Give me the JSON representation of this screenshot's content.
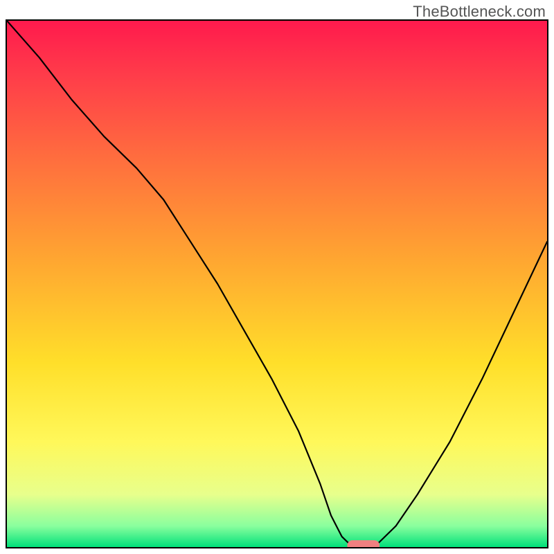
{
  "watermark": "TheBottleneck.com",
  "colors": {
    "gradient_stops": [
      {
        "offset": 0.0,
        "color": "#ff1a4d"
      },
      {
        "offset": 0.1,
        "color": "#ff3b4a"
      },
      {
        "offset": 0.25,
        "color": "#ff6a3f"
      },
      {
        "offset": 0.45,
        "color": "#ffa531"
      },
      {
        "offset": 0.65,
        "color": "#ffdf2a"
      },
      {
        "offset": 0.8,
        "color": "#fff85a"
      },
      {
        "offset": 0.9,
        "color": "#e8ff8c"
      },
      {
        "offset": 0.96,
        "color": "#8aff9e"
      },
      {
        "offset": 1.0,
        "color": "#00e07a"
      }
    ],
    "curve": "#000000",
    "marker": "#f08080",
    "border": "#000000"
  },
  "chart_data": {
    "type": "line",
    "title": "",
    "xlabel": "",
    "ylabel": "",
    "xlim": [
      0,
      100
    ],
    "ylim": [
      0,
      100
    ],
    "grid": false,
    "legend": false,
    "note": "No tick labels or axis text are rendered in the image; x/y units are normalized 0–100. Values are estimated from pixel positions.",
    "series": [
      {
        "name": "curve",
        "x": [
          0,
          6,
          12,
          18,
          24,
          29,
          34,
          39,
          44,
          49,
          54,
          58,
          60,
          62,
          64,
          68,
          72,
          76,
          82,
          88,
          94,
          100
        ],
        "y": [
          100,
          93,
          85,
          78,
          72,
          66,
          58,
          50,
          41,
          32,
          22,
          12,
          6,
          2,
          0,
          0,
          4,
          10,
          20,
          32,
          45,
          58
        ]
      }
    ],
    "marker": {
      "shape": "rounded-rect",
      "x_center": 66,
      "y_center": 0,
      "width": 6,
      "height": 2
    }
  }
}
